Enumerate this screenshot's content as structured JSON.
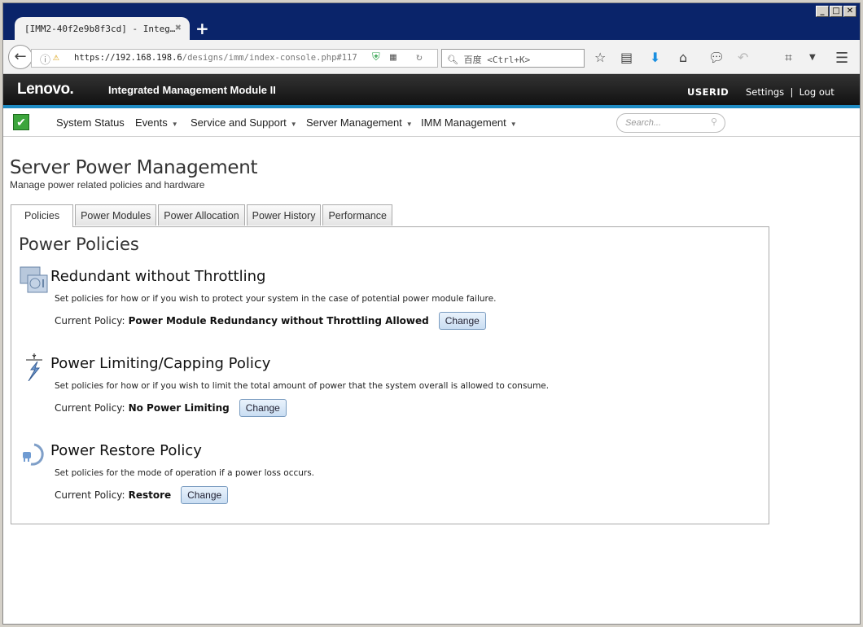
{
  "browser": {
    "tab_title": "[IMM2-40f2e9b8f3cd] - Integ…",
    "url_host": "https://192.168.198.6",
    "url_path": "/designs/imm/index-console.php#117",
    "search_placeholder": "百度 <Ctrl+K>"
  },
  "header": {
    "logo": "Lenovo.",
    "app_title": "Integrated Management Module II",
    "user": "USERID",
    "settings": "Settings",
    "separator": "|",
    "logout": "Log out"
  },
  "nav": {
    "items": [
      {
        "label": "System Status"
      },
      {
        "label": "Events"
      },
      {
        "label": "Service and Support"
      },
      {
        "label": "Server Management"
      },
      {
        "label": "IMM Management"
      }
    ],
    "search_placeholder": "Search..."
  },
  "page": {
    "title": "Server Power Management",
    "subtitle": "Manage power related policies and hardware",
    "tabs": [
      "Policies",
      "Power Modules",
      "Power Allocation",
      "Power History",
      "Performance"
    ],
    "panel_title": "Power Policies",
    "current_label": "Current Policy:",
    "change_label": "Change",
    "sections": [
      {
        "title": "Redundant without Throttling",
        "desc": "Set policies for how or if you wish to protect your system in the case of potential power module failure.",
        "value": "Power Module Redundancy without Throttling Allowed",
        "icon": "power-module-icon"
      },
      {
        "title": "Power Limiting/Capping Policy",
        "desc": "Set policies for how or if you wish to limit the total amount of power that the system overall is allowed to consume.",
        "value": "No Power Limiting",
        "icon": "power-capping-icon"
      },
      {
        "title": "Power Restore Policy",
        "desc": "Set policies for the mode of operation if a power loss occurs.",
        "value": "Restore",
        "icon": "power-restore-icon"
      }
    ]
  },
  "colors": {
    "accent": "#1e8bc3",
    "titlebar": "#0a246a"
  }
}
